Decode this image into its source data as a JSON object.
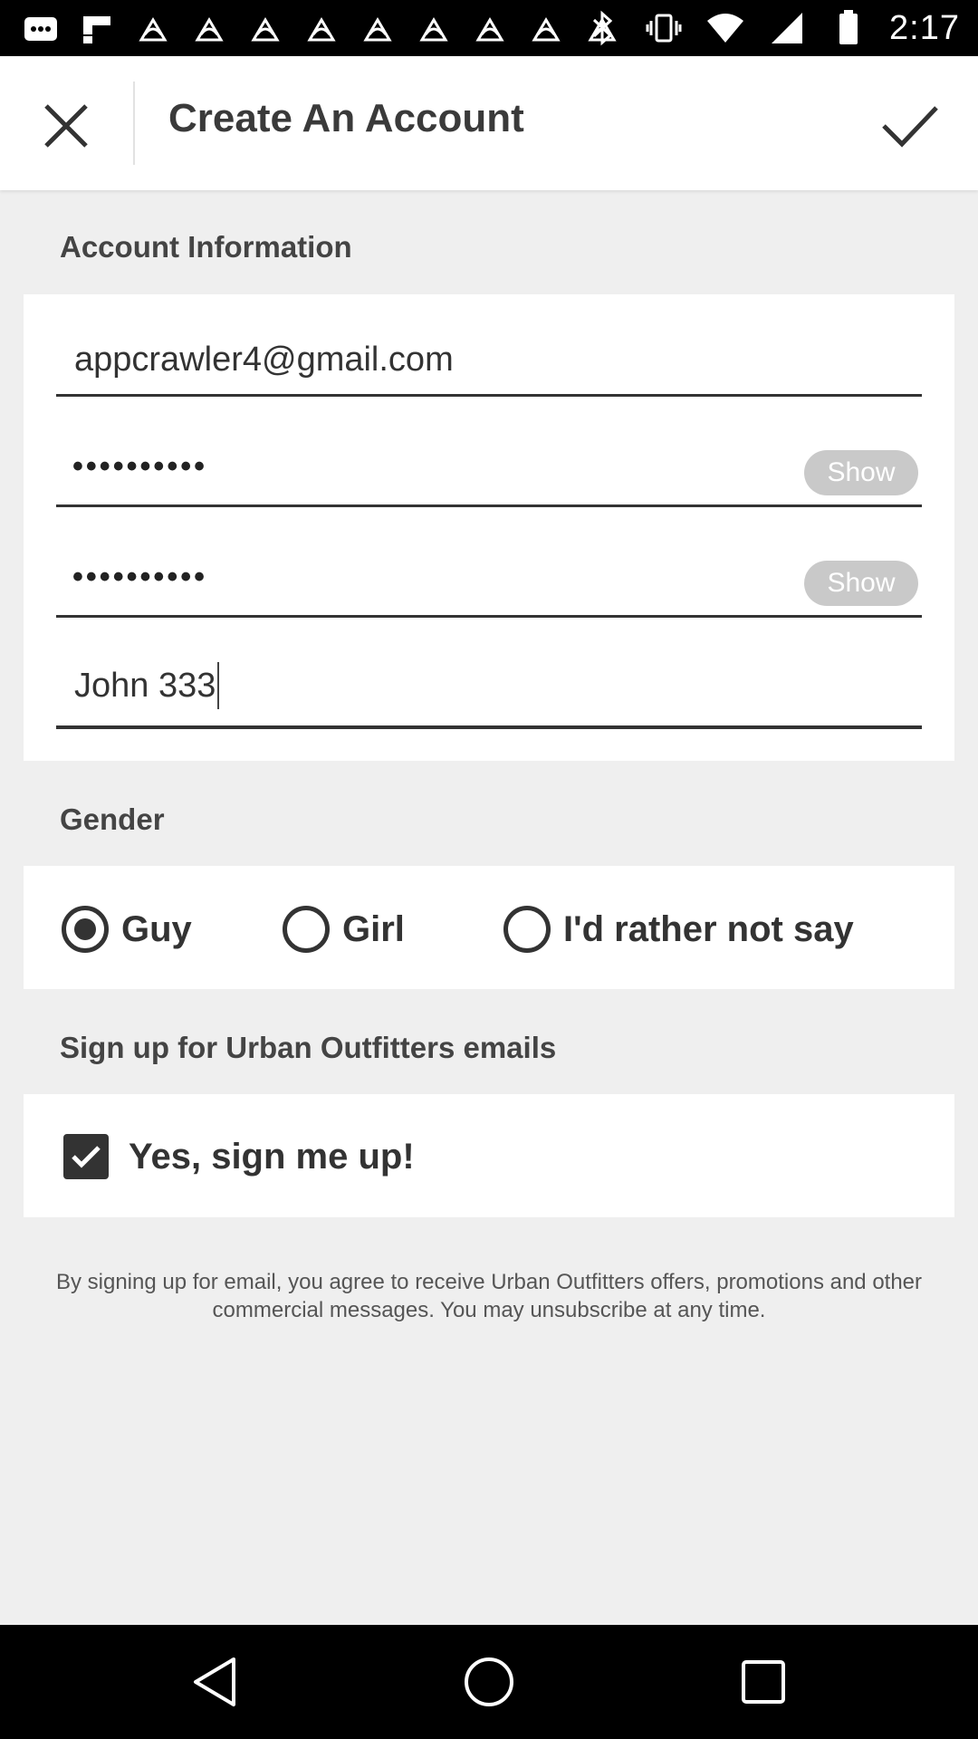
{
  "status_bar": {
    "time": "2:17",
    "notification_icons": [
      "messages-icon",
      "flipboard-icon",
      "app-icon",
      "app-icon",
      "app-icon",
      "app-icon",
      "app-icon",
      "app-icon",
      "app-icon",
      "app-icon",
      "app-icon"
    ],
    "system_icons": [
      "bluetooth-icon",
      "vibrate-icon",
      "wifi-icon",
      "signal-icon",
      "battery-icon"
    ]
  },
  "appbar": {
    "title": "Create An Account",
    "close_icon": "close-icon",
    "done_icon": "check-icon"
  },
  "account_section": {
    "label": "Account Information",
    "email_value": "appcrawler4@gmail.com",
    "password_value": "••••••••••",
    "password_show": "Show",
    "confirm_value": "••••••••••",
    "confirm_show": "Show",
    "name_value": "John 333"
  },
  "gender_section": {
    "label": "Gender",
    "options": [
      {
        "label": "Guy",
        "selected": true
      },
      {
        "label": "Girl",
        "selected": false
      },
      {
        "label": "I'd rather not say",
        "selected": false
      }
    ]
  },
  "email_section": {
    "label": "Sign up for Urban Outfitters emails",
    "checkbox_label": "Yes, sign me up!",
    "checked": true
  },
  "disclaimer": "By signing up for email, you agree to receive Urban Outfitters offers, promotions and other commercial messages. You may unsubscribe at any time.",
  "navbar": {
    "back_icon": "back-icon",
    "home_icon": "home-icon",
    "recents_icon": "recents-icon"
  }
}
